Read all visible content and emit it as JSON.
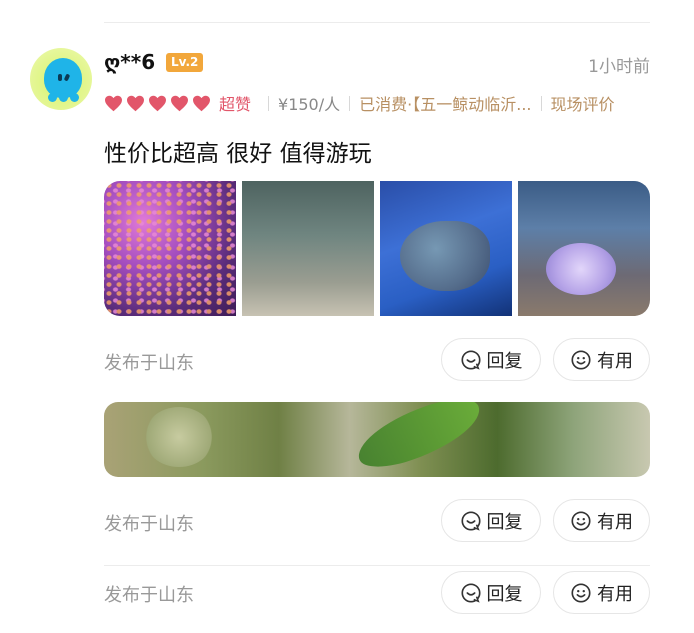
{
  "review": {
    "username": "ღ**6",
    "level": "Lv.2",
    "time": "1小时前",
    "rating_label": "超赞",
    "price": "¥150/人",
    "spend": "已消费·【五一鲸动临沂...",
    "scene_label": "现场评价",
    "text": "性价比超高 很好 值得游玩",
    "heart_color": "#e2566a",
    "photos": [
      "purple-jellyfish-photo",
      "fish-school-photo",
      "sea-turtle-photo",
      "coral-tank-photo"
    ]
  },
  "posts": [
    {
      "location": "发布于山东",
      "reply_label": "回复",
      "useful_label": "有用"
    },
    {
      "location": "发布于山东",
      "reply_label": "回复",
      "useful_label": "有用"
    },
    {
      "location": "发布于山东",
      "reply_label": "回复",
      "useful_label": "有用"
    }
  ]
}
